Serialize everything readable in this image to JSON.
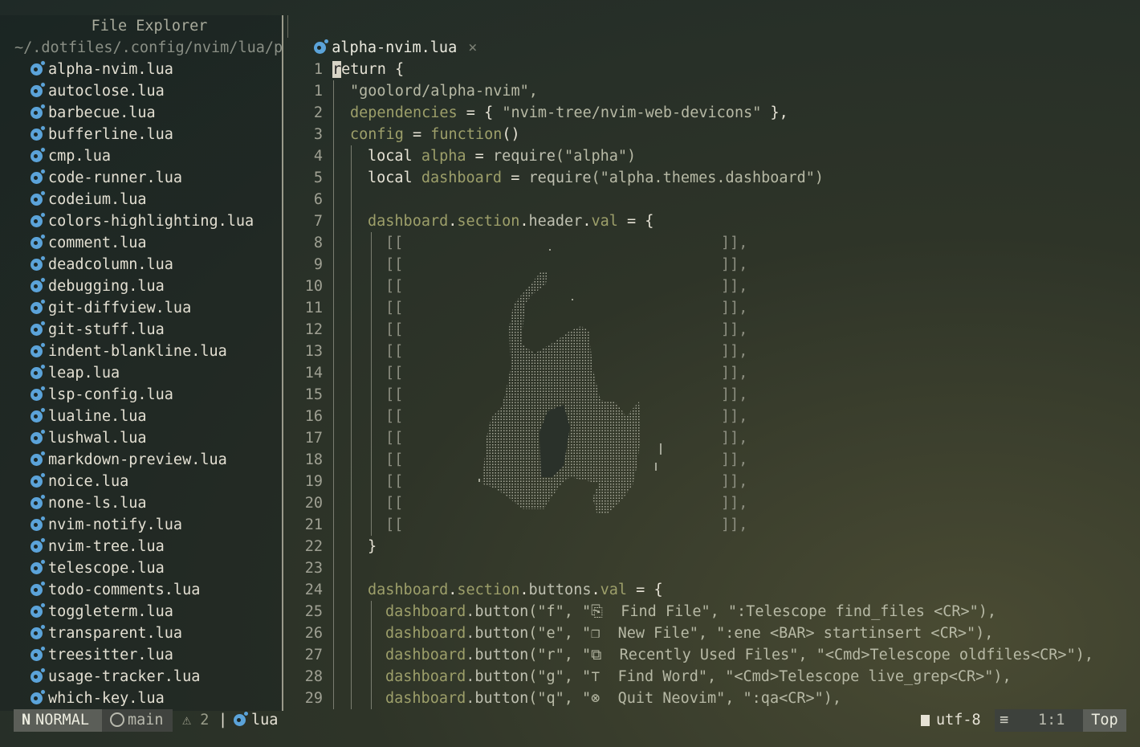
{
  "sidebar": {
    "title": "File Explorer",
    "path": "~/.dotfiles/.config/nvim/lua/p",
    "files": [
      "alpha-nvim.lua",
      "autoclose.lua",
      "barbecue.lua",
      "bufferline.lua",
      "cmp.lua",
      "code-runner.lua",
      "codeium.lua",
      "colors-highlighting.lua",
      "comment.lua",
      "deadcolumn.lua",
      "debugging.lua",
      "git-diffview.lua",
      "git-stuff.lua",
      "indent-blankline.lua",
      "leap.lua",
      "lsp-config.lua",
      "lualine.lua",
      "lushwal.lua",
      "markdown-preview.lua",
      "noice.lua",
      "none-ls.lua",
      "nvim-notify.lua",
      "nvim-tree.lua",
      "telescope.lua",
      "todo-comments.lua",
      "toggleterm.lua",
      "transparent.lua",
      "treesitter.lua",
      "usage-tracker.lua",
      "which-key.lua"
    ]
  },
  "tab": {
    "label": "alpha-nvim.lua",
    "close": "×"
  },
  "editor": {
    "line_numbers": [
      "1",
      "1",
      "2",
      "3",
      "4",
      "5",
      "6",
      "7",
      "8",
      "9",
      "10",
      "11",
      "12",
      "13",
      "14",
      "15",
      "16",
      "17",
      "18",
      "19",
      "20",
      "21",
      "22",
      "23",
      "24",
      "25",
      "26",
      "27",
      "28",
      "29"
    ],
    "header_open": "[[",
    "header_close": "]],",
    "lines": {
      "l0_cursor": "r",
      "l0_rest": "eturn {",
      "l1": "\"goolord/alpha-nvim\",",
      "l2_a": "dependencies",
      "l2_b": " = { ",
      "l2_c": "\"nvim-tree/nvim-web-devicons\"",
      "l2_d": " },",
      "l3_a": "config",
      "l3_b": " = ",
      "l3_c": "function",
      "l3_d": "()",
      "l4_a": "local ",
      "l4_b": "alpha",
      "l4_c": " = ",
      "l4_d": "require",
      "l4_e": "(\"alpha\")",
      "l5_a": "local ",
      "l5_b": "dashboard",
      "l5_c": " = ",
      "l5_d": "require",
      "l5_e": "(\"alpha.themes.dashboard\")",
      "l7_a": "dashboard",
      "l7_b": ".",
      "l7_c": "section",
      "l7_d": ".",
      "l7_e": "header",
      "l7_f": ".",
      "l7_g": "val",
      "l7_h": " = {",
      "l22": "}",
      "l24_a": "dashboard",
      "l24_b": ".",
      "l24_c": "section",
      "l24_d": ".",
      "l24_e": "buttons",
      "l24_f": ".",
      "l24_g": "val",
      "l24_h": " = {",
      "btn_obj": "dashboard",
      "btn_fn": ".button",
      "b25": "(\"f\", \"⎘  Find File\", \":Telescope find_files <CR>\"),",
      "b26": "(\"e\", \"❐  New File\", \":ene <BAR> startinsert <CR>\"),",
      "b27": "(\"r\", \"⧉  Recently Used Files\", \"<Cmd>Telescope oldfiles<CR>\"),",
      "b28": "(\"g\", \"⊤  Find Word\", \"<Cmd>Telescope live_grep<CR>\"),",
      "b29": "(\"q\", \"⊗  Quit Neovim\", \":qa<CR>\"),"
    }
  },
  "status": {
    "mode": "NORMAL",
    "mode_icon": "N",
    "branch": "main",
    "warnings": "⚠ 2",
    "separator": "|",
    "filetype": "lua",
    "encoding": "utf-8",
    "position": "1:1",
    "scroll": "Top"
  },
  "colors": {
    "accent_lua": "#5ba3d9",
    "identifier": "#9d9f6a"
  }
}
